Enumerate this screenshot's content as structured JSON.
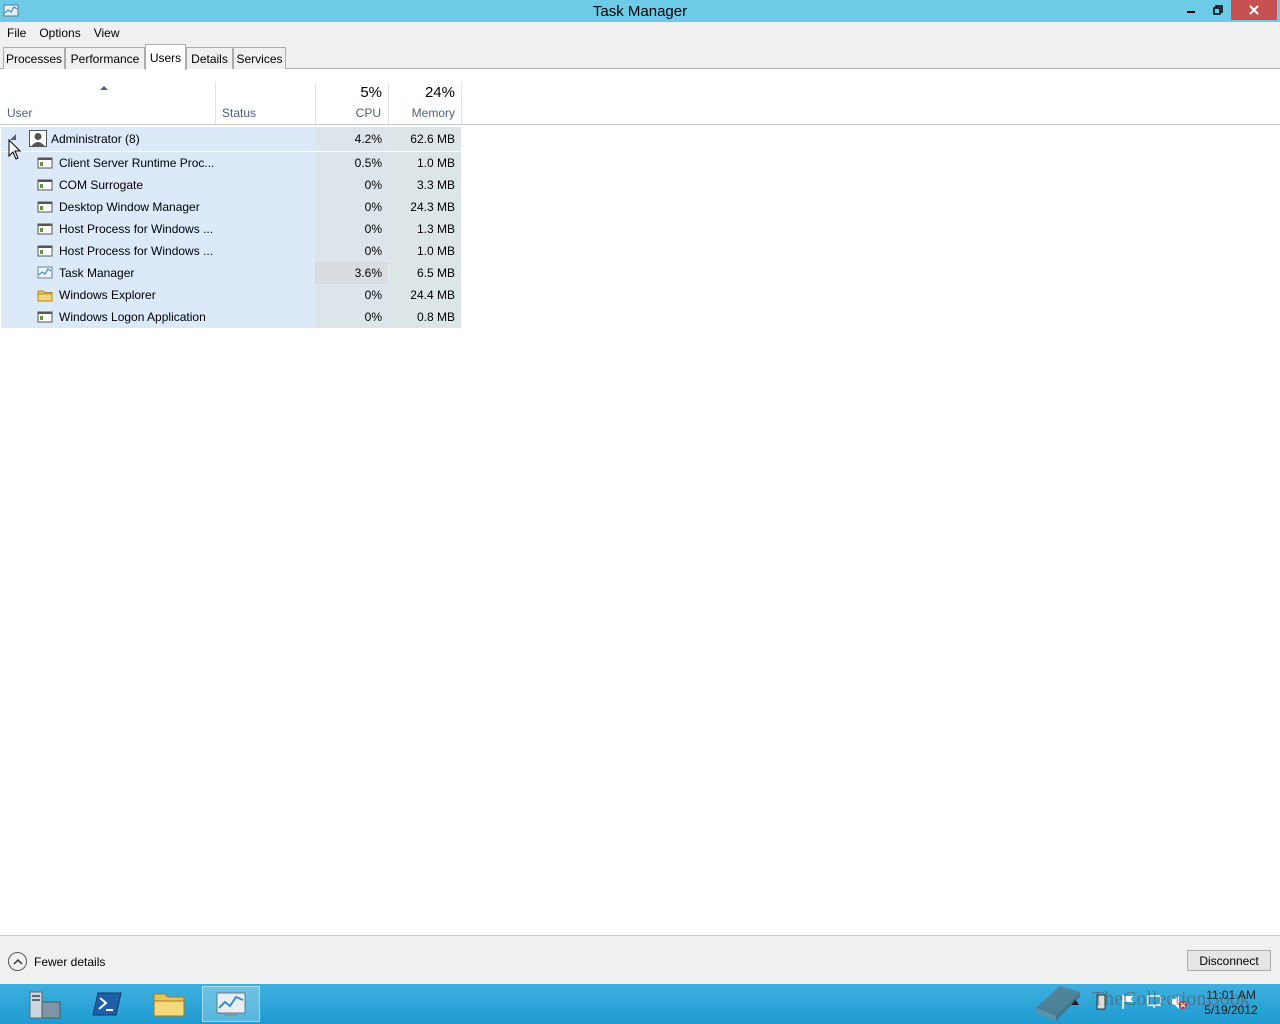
{
  "window": {
    "title": "Task Manager"
  },
  "menu": {
    "file": "File",
    "options": "Options",
    "view": "View"
  },
  "tabs": [
    {
      "label": "Processes"
    },
    {
      "label": "Performance"
    },
    {
      "label": "Users"
    },
    {
      "label": "Details"
    },
    {
      "label": "Services"
    }
  ],
  "columns": {
    "user": "User",
    "status": "Status",
    "cpu": {
      "label": "CPU",
      "total": "5%"
    },
    "memory": {
      "label": "Memory",
      "total": "24%"
    }
  },
  "user_row": {
    "name": "Administrator (8)",
    "cpu": "4.2%",
    "memory": "62.6 MB"
  },
  "processes": [
    {
      "name": "Client Server Runtime Proc...",
      "cpu": "0.5%",
      "memory": "1.0 MB",
      "icon": "app-window-icon"
    },
    {
      "name": "COM Surrogate",
      "cpu": "0%",
      "memory": "3.3 MB",
      "icon": "app-window-icon"
    },
    {
      "name": "Desktop Window Manager",
      "cpu": "0%",
      "memory": "24.3 MB",
      "icon": "app-window-icon"
    },
    {
      "name": "Host Process for Windows ...",
      "cpu": "0%",
      "memory": "1.3 MB",
      "icon": "app-window-icon"
    },
    {
      "name": "Host Process for Windows ...",
      "cpu": "0%",
      "memory": "1.0 MB",
      "icon": "app-window-icon"
    },
    {
      "name": "Task Manager",
      "cpu": "3.6%",
      "memory": "6.5 MB",
      "icon": "task-manager-icon"
    },
    {
      "name": "Windows Explorer",
      "cpu": "0%",
      "memory": "24.4 MB",
      "icon": "folder-icon"
    },
    {
      "name": "Windows Logon Application",
      "cpu": "0%",
      "memory": "0.8 MB",
      "icon": "app-window-icon"
    }
  ],
  "footer": {
    "fewer_details": "Fewer details",
    "disconnect": "Disconnect"
  },
  "taskbar": {
    "time": "11:01 AM",
    "date": "5/19/2012"
  },
  "watermark": "TheCollectionBook",
  "colors": {
    "titlebar": "#6ecbe8",
    "selection": "#dbe9f9",
    "taskbar": "#1f9ad2",
    "close": "#c75050"
  }
}
